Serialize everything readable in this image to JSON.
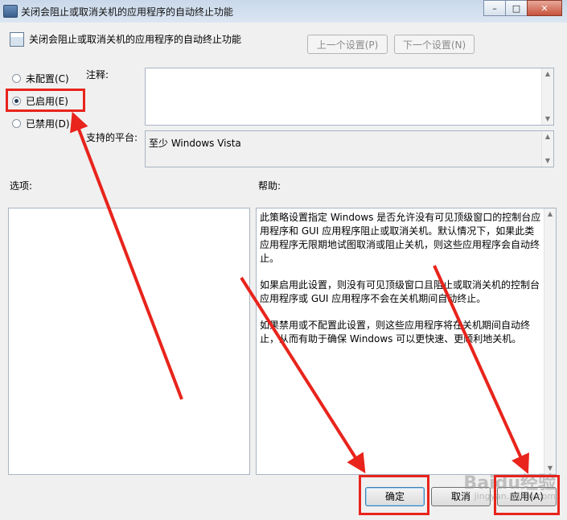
{
  "window": {
    "title": "关闭会阻止或取消关机的应用程序的自动终止功能",
    "controls": {
      "minimize": "–",
      "maximize": "□",
      "close": "✕"
    }
  },
  "header": {
    "policy_title": "关闭会阻止或取消关机的应用程序的自动终止功能",
    "prev_label": "上一个设置(P)",
    "next_label": "下一个设置(N)"
  },
  "radios": [
    {
      "label": "未配置(C)",
      "checked": false
    },
    {
      "label": "已启用(E)",
      "checked": true
    },
    {
      "label": "已禁用(D)",
      "checked": false
    }
  ],
  "comment": {
    "label": "注释:",
    "value": ""
  },
  "platform": {
    "label": "支持的平台:",
    "value": "至少 Windows Vista"
  },
  "options": {
    "label": "选项:"
  },
  "help": {
    "label": "帮助:",
    "paragraphs": [
      "此策略设置指定 Windows 是否允许没有可见顶级窗口的控制台应用程序和 GUI 应用程序阻止或取消关机。默认情况下，如果此类应用程序无限期地试图取消或阻止关机，则这些应用程序会自动终止。",
      "如果启用此设置，则没有可见顶级窗口且阻止或取消关机的控制台应用程序或 GUI 应用程序不会在关机期间自动终止。",
      "如果禁用或不配置此设置，则这些应用程序将在关机期间自动终止，从而有助于确保 Windows 可以更快速、更顺利地关机。"
    ]
  },
  "footer": {
    "ok_label": "确定",
    "cancel_label": "取消",
    "apply_label": "应用(A)"
  },
  "watermark": {
    "text": "Baidu经验",
    "url": "jingyan.baidu.com"
  },
  "colors": {
    "annotation": "#e8241c",
    "accent": "#3c7fb1"
  },
  "icons": {
    "app": "policy-window-icon",
    "policy": "policy-setting-icon"
  }
}
